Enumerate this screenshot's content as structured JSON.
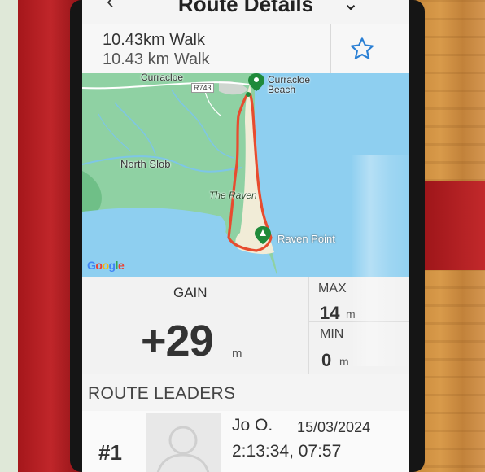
{
  "header": {
    "title": "Route Details",
    "back_icon": "chevron-left-icon",
    "menu_icon": "chevron-down-icon"
  },
  "route": {
    "name_primary": "10.43km Walk",
    "name_secondary": "10.43 km Walk",
    "favorite_icon": "star-outline-icon"
  },
  "map": {
    "labels": {
      "curracloe": "Curracloe",
      "curracloe_beach_line1": "Curracloe",
      "curracloe_beach_line2": "Beach",
      "north_slob": "North Slob",
      "the_raven": "The Raven",
      "raven_point": "Raven Point",
      "road": "R743"
    },
    "attribution": [
      "G",
      "o",
      "o",
      "g",
      "l",
      "e"
    ],
    "colors": {
      "route_line": "#e74c2f",
      "land": "#8fd1a3",
      "water": "#8ecff0",
      "sand": "#f1ecd7"
    }
  },
  "stats": {
    "gain_label": "GAIN",
    "gain_value": "+29",
    "gain_unit": "m",
    "max_label": "MAX",
    "max_value": "14",
    "max_unit": "m",
    "min_label": "MIN",
    "min_value": "0",
    "min_unit": "m"
  },
  "leaders": {
    "title": "ROUTE LEADERS",
    "items": [
      {
        "rank": "#1",
        "name": "Jo O.",
        "date": "15/03/2024",
        "time": "2:13:34, 07:57",
        "avatar_icon": "user-avatar-icon"
      }
    ]
  }
}
